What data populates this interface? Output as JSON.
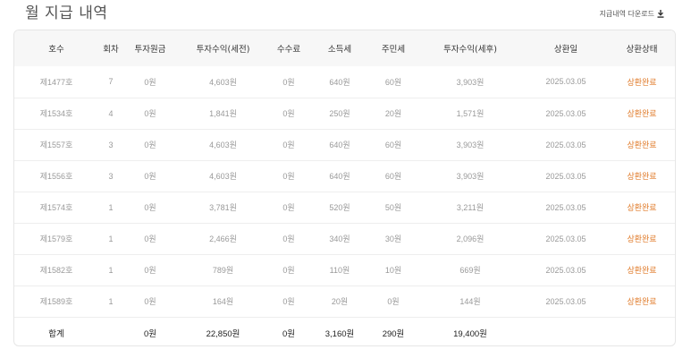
{
  "header": {
    "title": "월 지급 내역",
    "download_label": "지급내역 다운로드"
  },
  "colors": {
    "status": "#e07b2a"
  },
  "table": {
    "columns": [
      "호수",
      "회차",
      "투자원금",
      "투자수익(세전)",
      "수수료",
      "소득세",
      "주민세",
      "투자수익(세후)",
      "상환일",
      "상환상태"
    ],
    "rows": [
      {
        "no": "제1477호",
        "round": "7",
        "principal": "0원",
        "pretax": "4,603원",
        "fee": "0원",
        "income_tax": "640원",
        "local_tax": "60원",
        "aftertax": "3,903원",
        "date": "2025.03.05",
        "status": "상환완료"
      },
      {
        "no": "제1534호",
        "round": "4",
        "principal": "0원",
        "pretax": "1,841원",
        "fee": "0원",
        "income_tax": "250원",
        "local_tax": "20원",
        "aftertax": "1,571원",
        "date": "2025.03.05",
        "status": "상환완료"
      },
      {
        "no": "제1557호",
        "round": "3",
        "principal": "0원",
        "pretax": "4,603원",
        "fee": "0원",
        "income_tax": "640원",
        "local_tax": "60원",
        "aftertax": "3,903원",
        "date": "2025.03.05",
        "status": "상환완료"
      },
      {
        "no": "제1556호",
        "round": "3",
        "principal": "0원",
        "pretax": "4,603원",
        "fee": "0원",
        "income_tax": "640원",
        "local_tax": "60원",
        "aftertax": "3,903원",
        "date": "2025.03.05",
        "status": "상환완료"
      },
      {
        "no": "제1574호",
        "round": "1",
        "principal": "0원",
        "pretax": "3,781원",
        "fee": "0원",
        "income_tax": "520원",
        "local_tax": "50원",
        "aftertax": "3,211원",
        "date": "2025.03.05",
        "status": "상환완료"
      },
      {
        "no": "제1579호",
        "round": "1",
        "principal": "0원",
        "pretax": "2,466원",
        "fee": "0원",
        "income_tax": "340원",
        "local_tax": "30원",
        "aftertax": "2,096원",
        "date": "2025.03.05",
        "status": "상환완료"
      },
      {
        "no": "제1582호",
        "round": "1",
        "principal": "0원",
        "pretax": "789원",
        "fee": "0원",
        "income_tax": "110원",
        "local_tax": "10원",
        "aftertax": "669원",
        "date": "2025.03.05",
        "status": "상환완료"
      },
      {
        "no": "제1589호",
        "round": "1",
        "principal": "0원",
        "pretax": "164원",
        "fee": "0원",
        "income_tax": "20원",
        "local_tax": "0원",
        "aftertax": "144원",
        "date": "2025.03.05",
        "status": "상환완료"
      }
    ],
    "total": {
      "label": "합계",
      "principal": "0원",
      "pretax": "22,850원",
      "fee": "0원",
      "income_tax": "3,160원",
      "local_tax": "290원",
      "aftertax": "19,400원"
    }
  }
}
